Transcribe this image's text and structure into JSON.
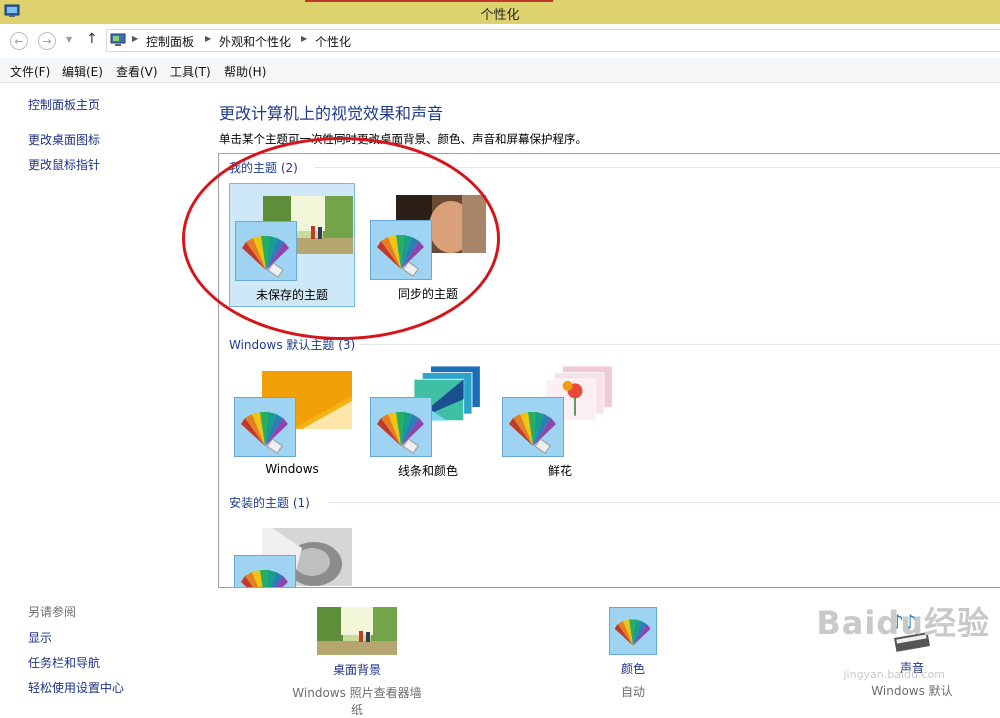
{
  "window": {
    "title": "个性化"
  },
  "address": {
    "crumbs": [
      "控制面板",
      "外观和个性化",
      "个性化"
    ]
  },
  "menu": [
    "文件(F)",
    "编辑(E)",
    "查看(V)",
    "工具(T)",
    "帮助(H)"
  ],
  "left_pane": {
    "home": "控制面板主页",
    "links": [
      "更改桌面图标",
      "更改鼠标指针"
    ],
    "see_also_title": "另请参阅",
    "see_also": [
      "显示",
      "任务栏和导航",
      "轻松使用设置中心"
    ]
  },
  "main": {
    "heading": "更改计算机上的视觉效果和声音",
    "subheading": "单击某个主题可一次性同时更改桌面背景、颜色、声音和屏幕保护程序。"
  },
  "groups": {
    "my": {
      "title": "我的主题 (2)",
      "themes": [
        "未保存的主题",
        "同步的主题"
      ]
    },
    "default": {
      "title": "Windows 默认主题 (3)",
      "themes": [
        "Windows",
        "线条和颜色",
        "鲜花"
      ]
    },
    "installed": {
      "title": "安装的主题 (1)"
    }
  },
  "settings": {
    "background": {
      "name": "桌面背景",
      "value": "Windows 照片查看器墙纸"
    },
    "color": {
      "name": "颜色",
      "value": "自动"
    },
    "sound": {
      "name": "声音",
      "value": "Windows 默认"
    }
  },
  "watermark": {
    "text": "Baidu经验",
    "url": "jingyan.baidu.com"
  },
  "colors": {
    "titlebar": "#ddd26e",
    "link": "#1e3287",
    "annotation": "#d8141b",
    "selected": "#cfe8f7"
  }
}
